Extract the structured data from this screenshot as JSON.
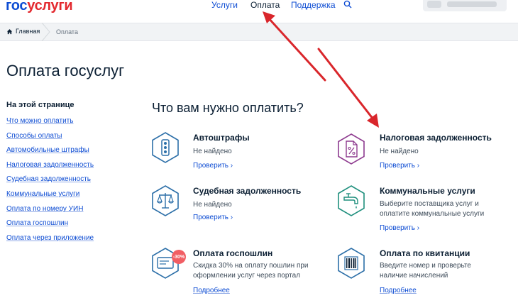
{
  "header": {
    "logo_part1": "гос",
    "logo_part2": "услуги",
    "nav": [
      {
        "label": "Услуги",
        "active": false
      },
      {
        "label": "Оплата",
        "active": true
      },
      {
        "label": "Поддержка",
        "active": false
      }
    ],
    "search_icon": "search-icon"
  },
  "breadcrumb": {
    "home_label": "Главная",
    "current_label": "Оплата"
  },
  "page_title": "Оплата госуслуг",
  "sidebar": {
    "title": "На этой странице",
    "links": [
      "Что можно оплатить",
      "Способы оплаты",
      "Автомобильные штрафы",
      "Налоговая задолженность",
      "Судебная задолженность",
      "Коммунальные услуги",
      "Оплата по номеру УИН",
      "Оплата госпошлин",
      "Оплата через приложение"
    ]
  },
  "main": {
    "question": "Что вам нужно оплатить?",
    "services": [
      {
        "title": "Автоштрафы",
        "text": [
          "Не найдено"
        ],
        "link": "Проверить",
        "icon": "traffic-light-icon",
        "color": "#2c6fa8"
      },
      {
        "title": "Налоговая задолженность",
        "text": [
          "Не найдено"
        ],
        "link": "Проверить",
        "icon": "tax-document-icon",
        "color": "#8e3b8f"
      },
      {
        "title": "Судебная задолженность",
        "text": [
          "Не найдено"
        ],
        "link": "Проверить",
        "icon": "scales-icon",
        "color": "#2c6fa8"
      },
      {
        "title": "Коммунальные услуги",
        "text": [
          "Выберите поставщика услуг и",
          "оплатите коммунальные услуги"
        ],
        "link": "Проверить",
        "icon": "water-tap-icon",
        "color": "#1f8f7d"
      },
      {
        "title": "Оплата госпошлин",
        "text": [
          "Скидка 30% на оплату пошлин при",
          "оформлении услуг через портал"
        ],
        "link": "Подробнее",
        "icon": "payment-card-icon",
        "color": "#2c6fa8",
        "badge": "-30%"
      },
      {
        "title": "Оплата по квитанции",
        "text": [
          "Введите номер и проверьте",
          "наличие начислений"
        ],
        "link": "Подробнее",
        "icon": "barcode-icon",
        "color": "#2c6fa8"
      }
    ]
  },
  "colors": {
    "accent": "#0d4cd3",
    "logo_red": "#e3292f",
    "annotation_arrow": "#d9262b"
  }
}
